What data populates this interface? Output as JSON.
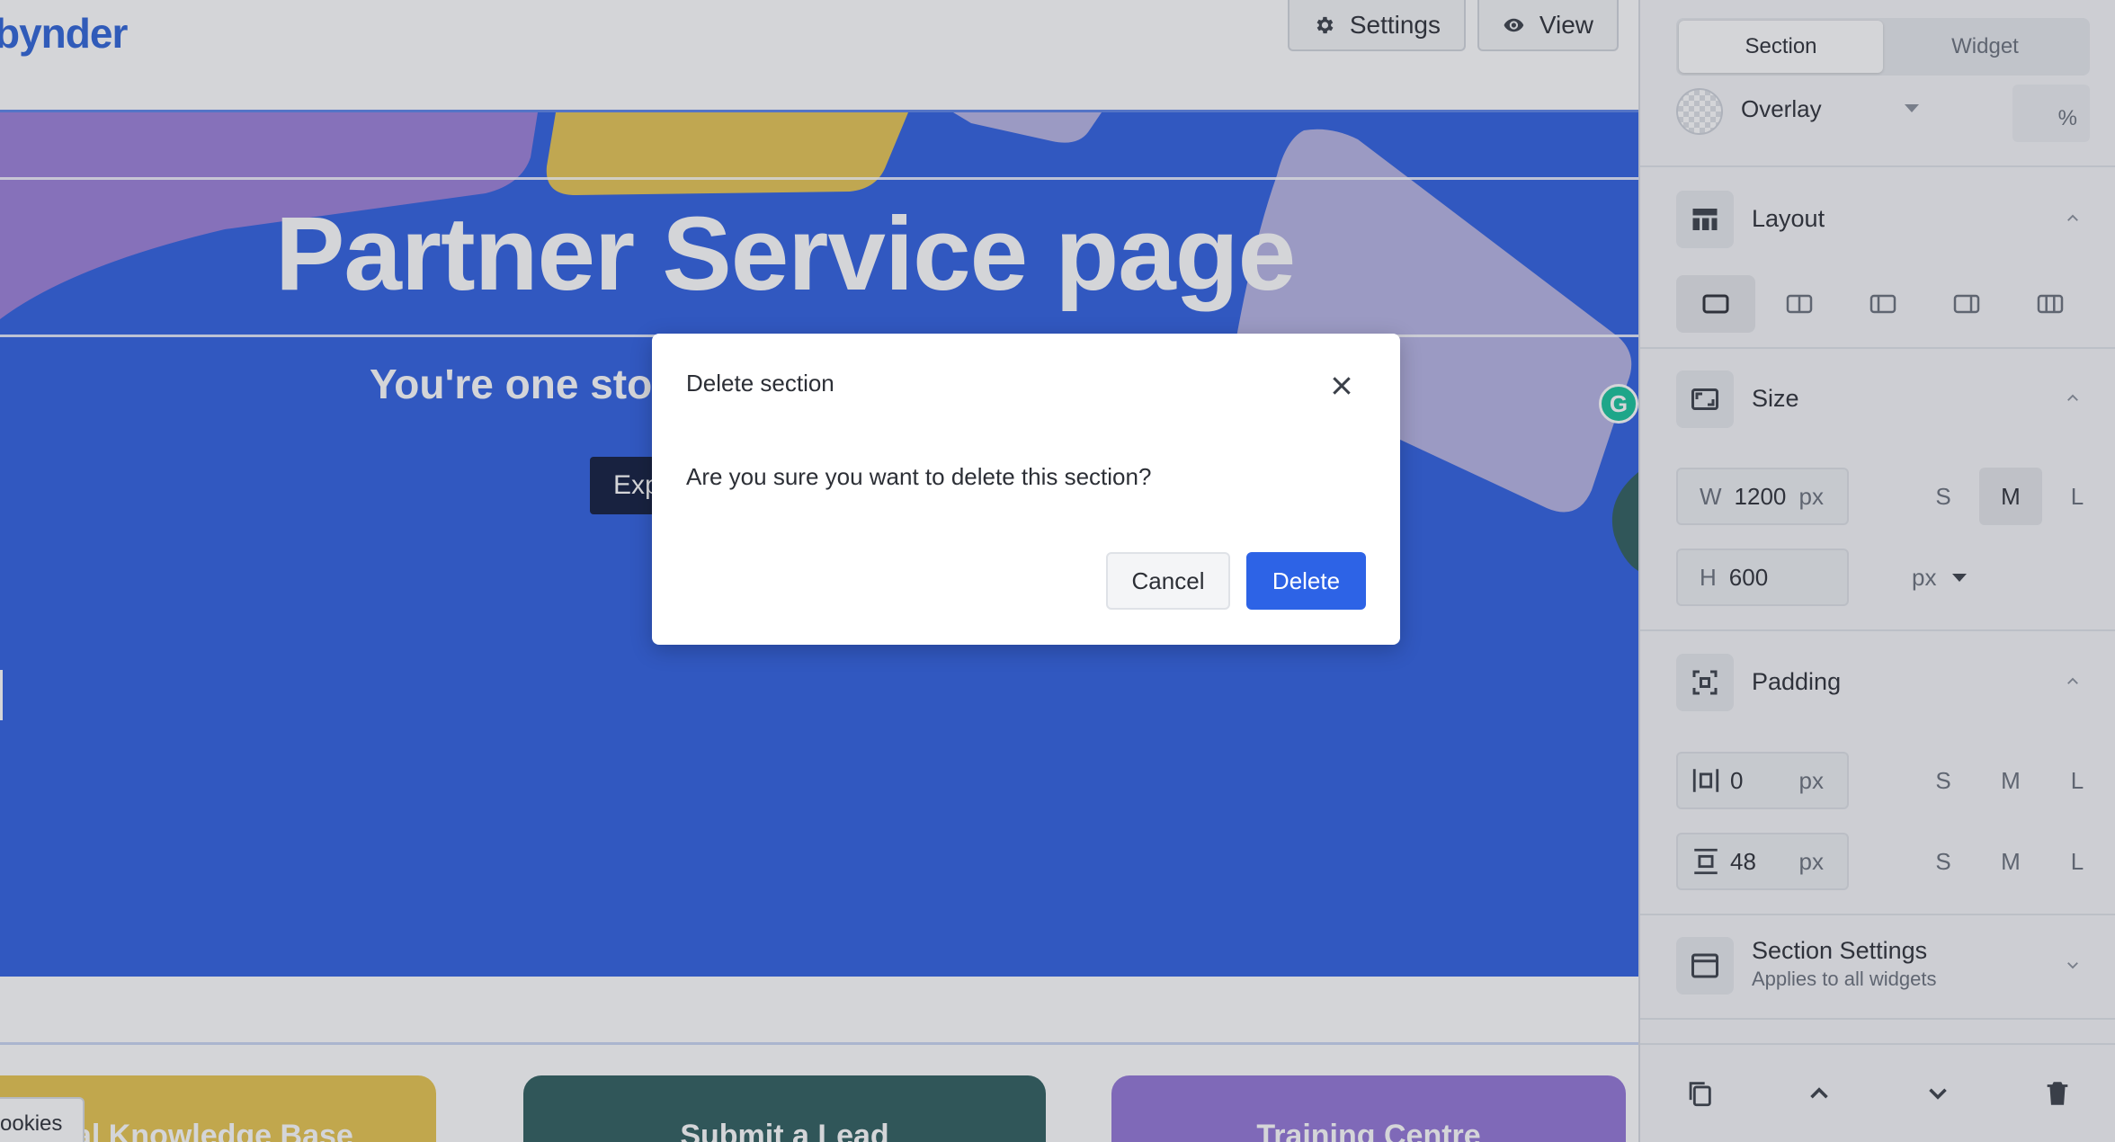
{
  "app": {
    "logo_text": "bynder"
  },
  "topbar": {
    "settings_label": "Settings",
    "view_label": "View"
  },
  "hero": {
    "title": "Partner Service page",
    "subtitle": "You're one stop",
    "cta_label": "Exp"
  },
  "cards": [
    {
      "label": "nal Knowledge Base"
    },
    {
      "label": "Submit a Lead"
    },
    {
      "label": "Training Centre"
    }
  ],
  "cookies_label": "ookies",
  "panel": {
    "tabs": [
      {
        "label": "Section",
        "active": true
      },
      {
        "label": "Widget",
        "active": false
      }
    ],
    "overlay": {
      "label": "Overlay",
      "percent_unit": "%"
    },
    "layout": {
      "title": "Layout"
    },
    "size": {
      "title": "Size",
      "width_prefix": "W",
      "width_value": "1200",
      "width_unit": "px",
      "height_prefix": "H",
      "height_value": "600",
      "unit_select": "px",
      "presets": [
        "S",
        "M",
        "L"
      ],
      "active_preset": "M"
    },
    "padding": {
      "title": "Padding",
      "horizontal_value": "0",
      "vertical_value": "48",
      "unit": "px",
      "presets": [
        "S",
        "M",
        "L"
      ]
    },
    "section_settings": {
      "title": "Section Settings",
      "subtitle": "Applies to all widgets"
    }
  },
  "modal": {
    "title": "Delete section",
    "body": "Are you sure you want to delete this section?",
    "cancel_label": "Cancel",
    "delete_label": "Delete"
  },
  "colors": {
    "hero_blue": "#2f5fe0",
    "primary_button": "#2d63e6",
    "card_yellow": "#e7c44e",
    "card_teal": "#2e5d5d",
    "card_purple": "#9375d6"
  }
}
